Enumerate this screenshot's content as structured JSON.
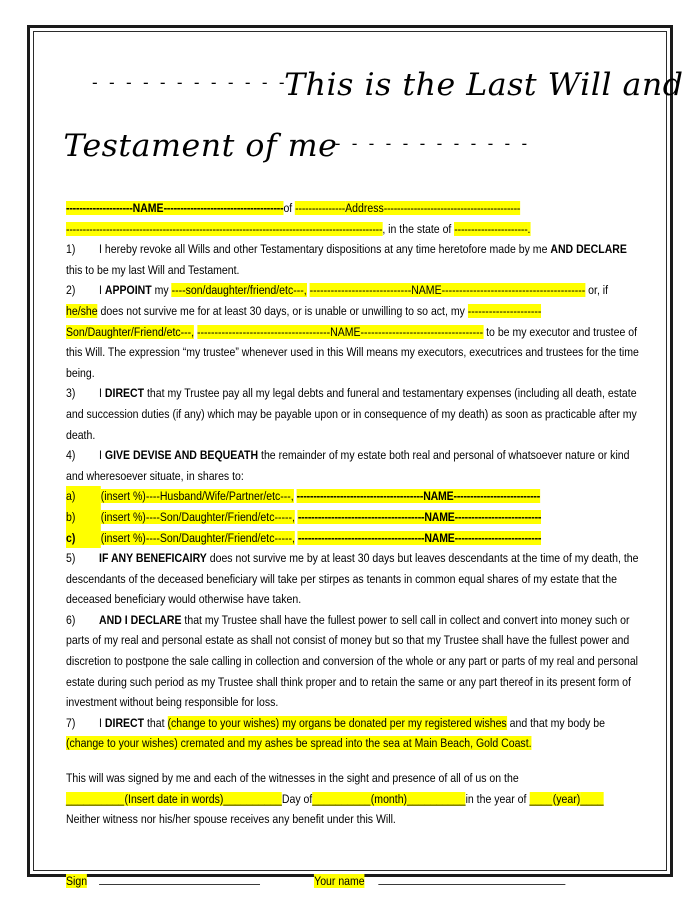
{
  "document": {
    "type": "last-will-and-testament-template",
    "highlight_color": "#FFFF00",
    "text_color": "#000000",
    "border_color": "#1a1a1a"
  },
  "title": {
    "line1_dashes": "- - - - - - - - - - - -",
    "line1_text": "This is the Last Will and",
    "line2_text": "Testament of me",
    "line2_dashes": "- - - - - - - - - - - -"
  },
  "header": {
    "dash_before_name": "--------------------",
    "name_label": "NAME",
    "dash_after_name": "------------------------------------",
    "of_text": "of",
    "dash_before_address": "---------------",
    "address_label": "Address",
    "dash_after_address": "-----------------------------------------",
    "line2_dashes": "-----------------------------------------------------------------------------------------------",
    "in_the_state_of": ", in the state of",
    "state_dashes": "----------------------",
    "period": "."
  },
  "clauses": [
    {
      "number": "1)",
      "segments": [
        {
          "text": "I hereby revoke all Wills and other Testamentary dispositions at any time heretofore made by me ",
          "bold": false,
          "highlight": false
        },
        {
          "text": "AND DECLARE",
          "bold": true,
          "highlight": false
        },
        {
          "text": " this to be my last Will and Testament.",
          "bold": false,
          "highlight": false
        }
      ]
    },
    {
      "number": "2)",
      "segments": [
        {
          "text": "I ",
          "bold": false,
          "highlight": false
        },
        {
          "text": "APPOINT",
          "bold": true,
          "highlight": false
        },
        {
          "text": " my ",
          "bold": false,
          "highlight": false
        },
        {
          "text": "----son/daughter/friend/etc---,",
          "bold": false,
          "highlight": true
        },
        {
          "text": "  ",
          "bold": false,
          "highlight": false
        },
        {
          "text": "-----------------------------NAME-----------------------------------------",
          "bold": false,
          "highlight": true
        },
        {
          "text": " or, if ",
          "bold": false,
          "highlight": false
        },
        {
          "text": "he/she",
          "bold": false,
          "highlight": true
        },
        {
          "text": " does not survive me for at least 30 days, or is unable or unwilling to so act, my ",
          "bold": false,
          "highlight": false
        },
        {
          "text": "---------------------",
          "bold": false,
          "highlight": true
        },
        {
          "text": " ",
          "bold": false,
          "highlight": false
        },
        {
          "text": "Son/Daughter/Friend/etc---,",
          "bold": false,
          "highlight": true
        },
        {
          "text": "  ",
          "bold": false,
          "highlight": false
        },
        {
          "text": "--------------------------------------NAME-----------------------------------",
          "bold": false,
          "highlight": true
        },
        {
          "text": " to be my executor and trustee of this Will. The expression “my trustee” whenever used in this Will means my executors, executrices and trustees for the time being.",
          "bold": false,
          "highlight": false
        }
      ]
    },
    {
      "number": "3)",
      "segments": [
        {
          "text": "I ",
          "bold": false,
          "highlight": false
        },
        {
          "text": "DIRECT",
          "bold": true,
          "highlight": false
        },
        {
          "text": " that my Trustee pay all my legal debts and funeral and testamentary expenses (including all death, estate and succession duties (if any) which may be payable upon or in consequence of my death) as soon as practicable after my death.",
          "bold": false,
          "highlight": false
        }
      ]
    },
    {
      "number": "4)",
      "segments": [
        {
          "text": "I ",
          "bold": false,
          "highlight": false
        },
        {
          "text": "GIVE DEVISE AND BEQUEATH",
          "bold": true,
          "highlight": false
        },
        {
          "text": " the remainder of my estate both real and personal of whatsoever nature or kind and wheresoever situate, in shares to:",
          "bold": false,
          "highlight": false
        }
      ]
    }
  ],
  "beneficiaries": [
    {
      "label": "a)",
      "label_bold": false,
      "text": "(insert %)----Husband/Wife/Partner/etc---,",
      "name_dashes": "--------------------------------------NAME--------------------------"
    },
    {
      "label": "b)",
      "label_bold": false,
      "text": "(insert %)----Son/Daughter/Friend/etc-----,",
      "name_dashes": "--------------------------------------NAME--------------------------"
    },
    {
      "label": "c)",
      "label_bold": true,
      "text": "(insert %)----Son/Daughter/Friend/etc-----,",
      "name_dashes": "--------------------------------------NAME--------------------------"
    }
  ],
  "clauses_cont": [
    {
      "number": "5)",
      "segments": [
        {
          "text": "IF ANY BENEFICAIRY",
          "bold": true,
          "highlight": false
        },
        {
          "text": " does not survive me by at least 30 days but leaves descendants at the time of my death, the descendants of the deceased beneficiary will take per stirpes as tenants in common equal shares of my estate that the deceased beneficiary would otherwise have taken.",
          "bold": false,
          "highlight": false
        }
      ]
    },
    {
      "number": "6)",
      "segments": [
        {
          "text": "AND I DECLARE",
          "bold": true,
          "highlight": false
        },
        {
          "text": " that my Trustee shall have the fullest power to sell call in collect and convert into  money such or parts of my real and personal estate as shall not consist of money but so that my Trustee shall have the fullest power and discretion to postpone the sale calling in collection and conversion of the whole or any part or parts of my real and personal estate during such period as my Trustee shall think proper and to retain the same or any part thereof in its present form of investment without being responsible for loss.",
          "bold": false,
          "highlight": false
        }
      ]
    },
    {
      "number": "7)",
      "segments": [
        {
          "text": "I ",
          "bold": false,
          "highlight": false
        },
        {
          "text": "DIRECT",
          "bold": true,
          "highlight": false
        },
        {
          "text": " that ",
          "bold": false,
          "highlight": false
        },
        {
          "text": "(change to your wishes) my organs be donated per my registered wishes",
          "bold": false,
          "highlight": true
        },
        {
          "text": " and that my body be ",
          "bold": false,
          "highlight": false
        },
        {
          "text": "(change to your wishes) cremated and my ashes be spread into the sea at Main Beach, Gold Coast.",
          "bold": false,
          "highlight": true
        }
      ]
    }
  ],
  "attestation": {
    "intro": "This will was signed by me and each of the witnesses in the sight and presence of all of us on the",
    "blank_date_pre": "__________",
    "date_label": "(Insert date in words)",
    "blank_date_post": "__________",
    "day_of": "Day of",
    "blank_month_pre": "__________",
    "month_label": "(month)",
    "blank_month_post": "__________",
    "in_the_year_of": "in the year of",
    "blank_year_pre": "____",
    "year_label": "(year)",
    "blank_year_post": "____",
    "witness_note": "Neither witness nor his/her spouse receives any benefit under this Will."
  },
  "signature": {
    "sign_label": "Sign",
    "your_name_label": "Your name"
  }
}
